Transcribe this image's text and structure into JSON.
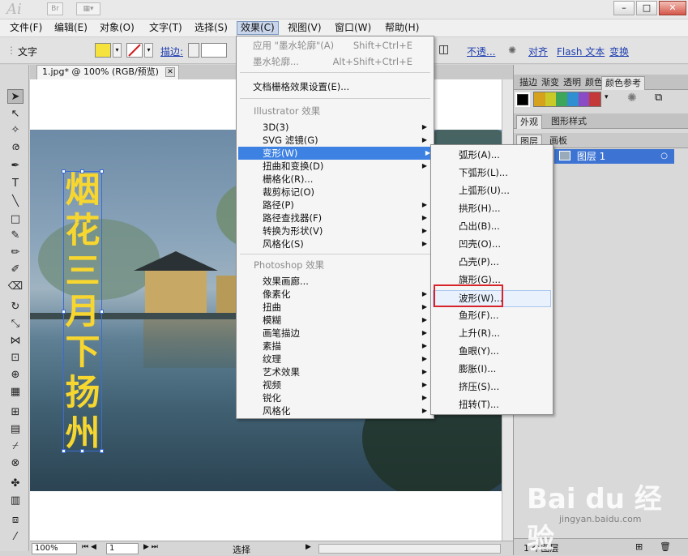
{
  "app": {
    "logo": "Ai",
    "bridge": "Br"
  },
  "window_buttons": {
    "minimize": "–",
    "maximize": "□",
    "close": "✕"
  },
  "menubar": [
    {
      "label": "文件(F)"
    },
    {
      "label": "编辑(E)"
    },
    {
      "label": "对象(O)"
    },
    {
      "label": "文字(T)"
    },
    {
      "label": "选择(S)"
    },
    {
      "label": "效果(C)"
    },
    {
      "label": "视图(V)"
    },
    {
      "label": "窗口(W)"
    },
    {
      "label": "帮助(H)"
    }
  ],
  "controlbar": {
    "tool_name": "文字",
    "stroke_label": "描边:",
    "opacity_label": "不透...",
    "align_label": "对齐",
    "flash_text_label": "Flash 文本",
    "transform_label": "变换",
    "fill_color": "#f5e23c",
    "stroke_color": "none"
  },
  "document": {
    "tab_title": "1.jpg* @ 100% (RGB/预览)",
    "vertical_text": "烟花三月下扬州",
    "text_color": "#f7d630"
  },
  "statusbar": {
    "zoom": "100%",
    "page": "1",
    "mode": "选择"
  },
  "effect_menu": {
    "apply_last": "应用 \"墨水轮廓\"(A)",
    "apply_last_shortcut": "Shift+Ctrl+E",
    "last_effect": "墨水轮廓...",
    "last_effect_shortcut": "Alt+Shift+Ctrl+E",
    "raster_settings": "文档栅格效果设置(E)...",
    "illustrator_header": "Illustrator 效果",
    "illustrator_items": [
      "3D(3)",
      "SVG 滤镜(G)",
      "变形(W)",
      "扭曲和变换(D)",
      "栅格化(R)...",
      "裁剪标记(O)",
      "路径(P)",
      "路径查找器(F)",
      "转换为形状(V)",
      "风格化(S)"
    ],
    "photoshop_header": "Photoshop 效果",
    "photoshop_items": [
      "效果画廊...",
      "像素化",
      "扭曲",
      "模糊",
      "画笔描边",
      "素描",
      "纹理",
      "艺术效果",
      "视频",
      "锐化",
      "风格化"
    ]
  },
  "warp_menu": {
    "items": [
      "弧形(A)...",
      "下弧形(L)...",
      "上弧形(U)...",
      "拱形(H)...",
      "凸出(B)...",
      "凹壳(O)...",
      "凸壳(P)...",
      "旗形(G)...",
      "波形(W)...",
      "鱼形(F)...",
      "上升(R)...",
      "鱼眼(Y)...",
      "膨胀(I)...",
      "挤压(S)...",
      "扭转(T)..."
    ],
    "highlighted": "波形(W)..."
  },
  "panels": {
    "top_tabs": [
      "描边",
      "渐变",
      "透明",
      "颜色",
      "颜色参考"
    ],
    "appearance_tabs": [
      "外观",
      "图形样式"
    ],
    "layer_tabs": [
      "图层",
      "画板"
    ],
    "layer_name": "图层 1",
    "layer_count": "1 个图层",
    "guide_colors": [
      "#d6a21e",
      "#c9c92a",
      "#3da65a",
      "#2f8fd0",
      "#8b4bc4",
      "#c43a3a"
    ]
  },
  "watermark": {
    "brand": "Bai du 经验",
    "url": "jingyan.baidu.com"
  }
}
